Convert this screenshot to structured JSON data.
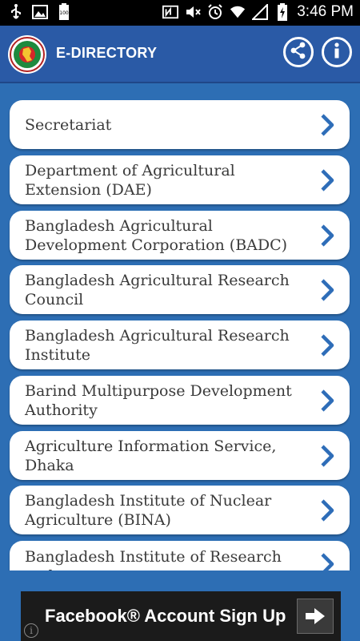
{
  "status_bar": {
    "time": "3:46 PM",
    "battery_icon_text": "100"
  },
  "app": {
    "title": "E-DIRECTORY"
  },
  "list_items": [
    {
      "label": "Secretariat"
    },
    {
      "label": "Department of Agricultural Extension (DAE)"
    },
    {
      "label": "Bangladesh Agricultural Development Corporation (BADC)"
    },
    {
      "label": "Bangladesh Agricultural Research Council"
    },
    {
      "label": "Bangladesh Agricultural Research Institute"
    },
    {
      "label": "Barind Multipurpose Development Authority"
    },
    {
      "label": "Agriculture Information Service, Dhaka"
    },
    {
      "label": "Bangladesh Institute of Nuclear Agriculture (BINA)"
    },
    {
      "label": "Bangladesh Institute of Research and"
    }
  ],
  "ad": {
    "text": "Facebook® Account Sign Up",
    "info_glyph": "i"
  },
  "colors": {
    "background": "#2d6eb4",
    "header": "#2a5aa6",
    "arrow": "#2e6db8",
    "item_text": "#3a3a3a"
  }
}
